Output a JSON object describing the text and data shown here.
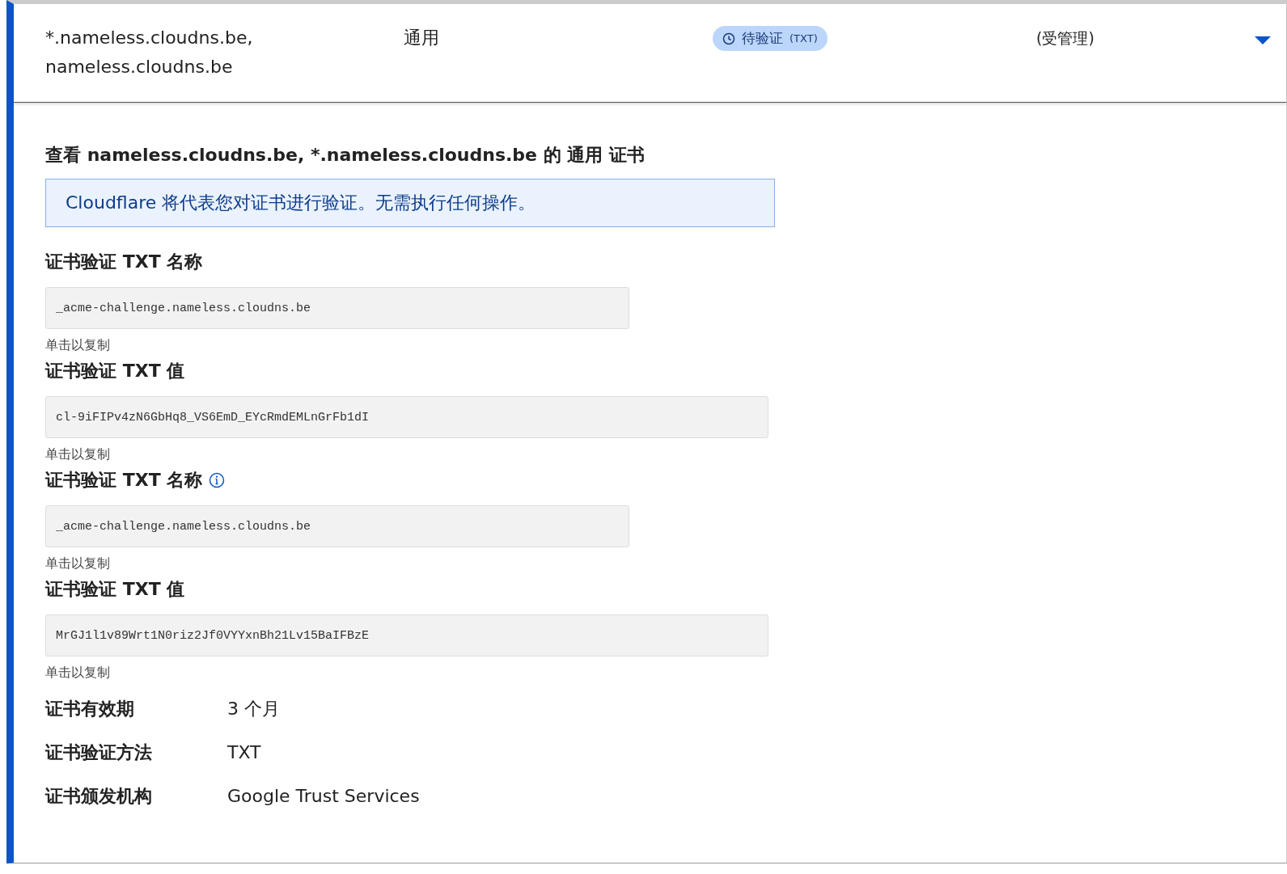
{
  "row": {
    "hostnames": [
      "*.nameless.cloudns.be,",
      "nameless.cloudns.be"
    ],
    "type": "通用",
    "status": {
      "label": "待验证",
      "method": "(TXT)"
    },
    "managed": "(受管理)",
    "expanded": true
  },
  "details": {
    "title": "查看 nameless.cloudns.be, *.nameless.cloudns.be 的 通用 证书",
    "notice": "Cloudflare 将代表您对证书进行验证。无需执行任何操作。",
    "fields": [
      {
        "kind": "name",
        "label": "证书验证 TXT 名称",
        "info": false,
        "value": "_acme-challenge.nameless.cloudns.be",
        "hint": "单击以复制"
      },
      {
        "kind": "value",
        "label": "证书验证 TXT 值",
        "info": false,
        "value": "cl-9iFIPv4zN6GbHq8_VS6EmD_EYcRmdEMLnGrFb1dI",
        "hint": "单击以复制"
      },
      {
        "kind": "name",
        "label": "证书验证 TXT 名称",
        "info": true,
        "value": "_acme-challenge.nameless.cloudns.be",
        "hint": "单击以复制"
      },
      {
        "kind": "value",
        "label": "证书验证 TXT 值",
        "info": false,
        "value": "MrGJ1l1v89Wrt1N0riz2Jf0VYYxnBh21Lv15BaIFBzE",
        "hint": "单击以复制"
      }
    ],
    "properties": [
      {
        "label": "证书有效期",
        "value": "3 个月"
      },
      {
        "label": "证书验证方法",
        "value": "TXT"
      },
      {
        "label": "证书颁发机构",
        "value": "Google Trust Services"
      }
    ]
  }
}
